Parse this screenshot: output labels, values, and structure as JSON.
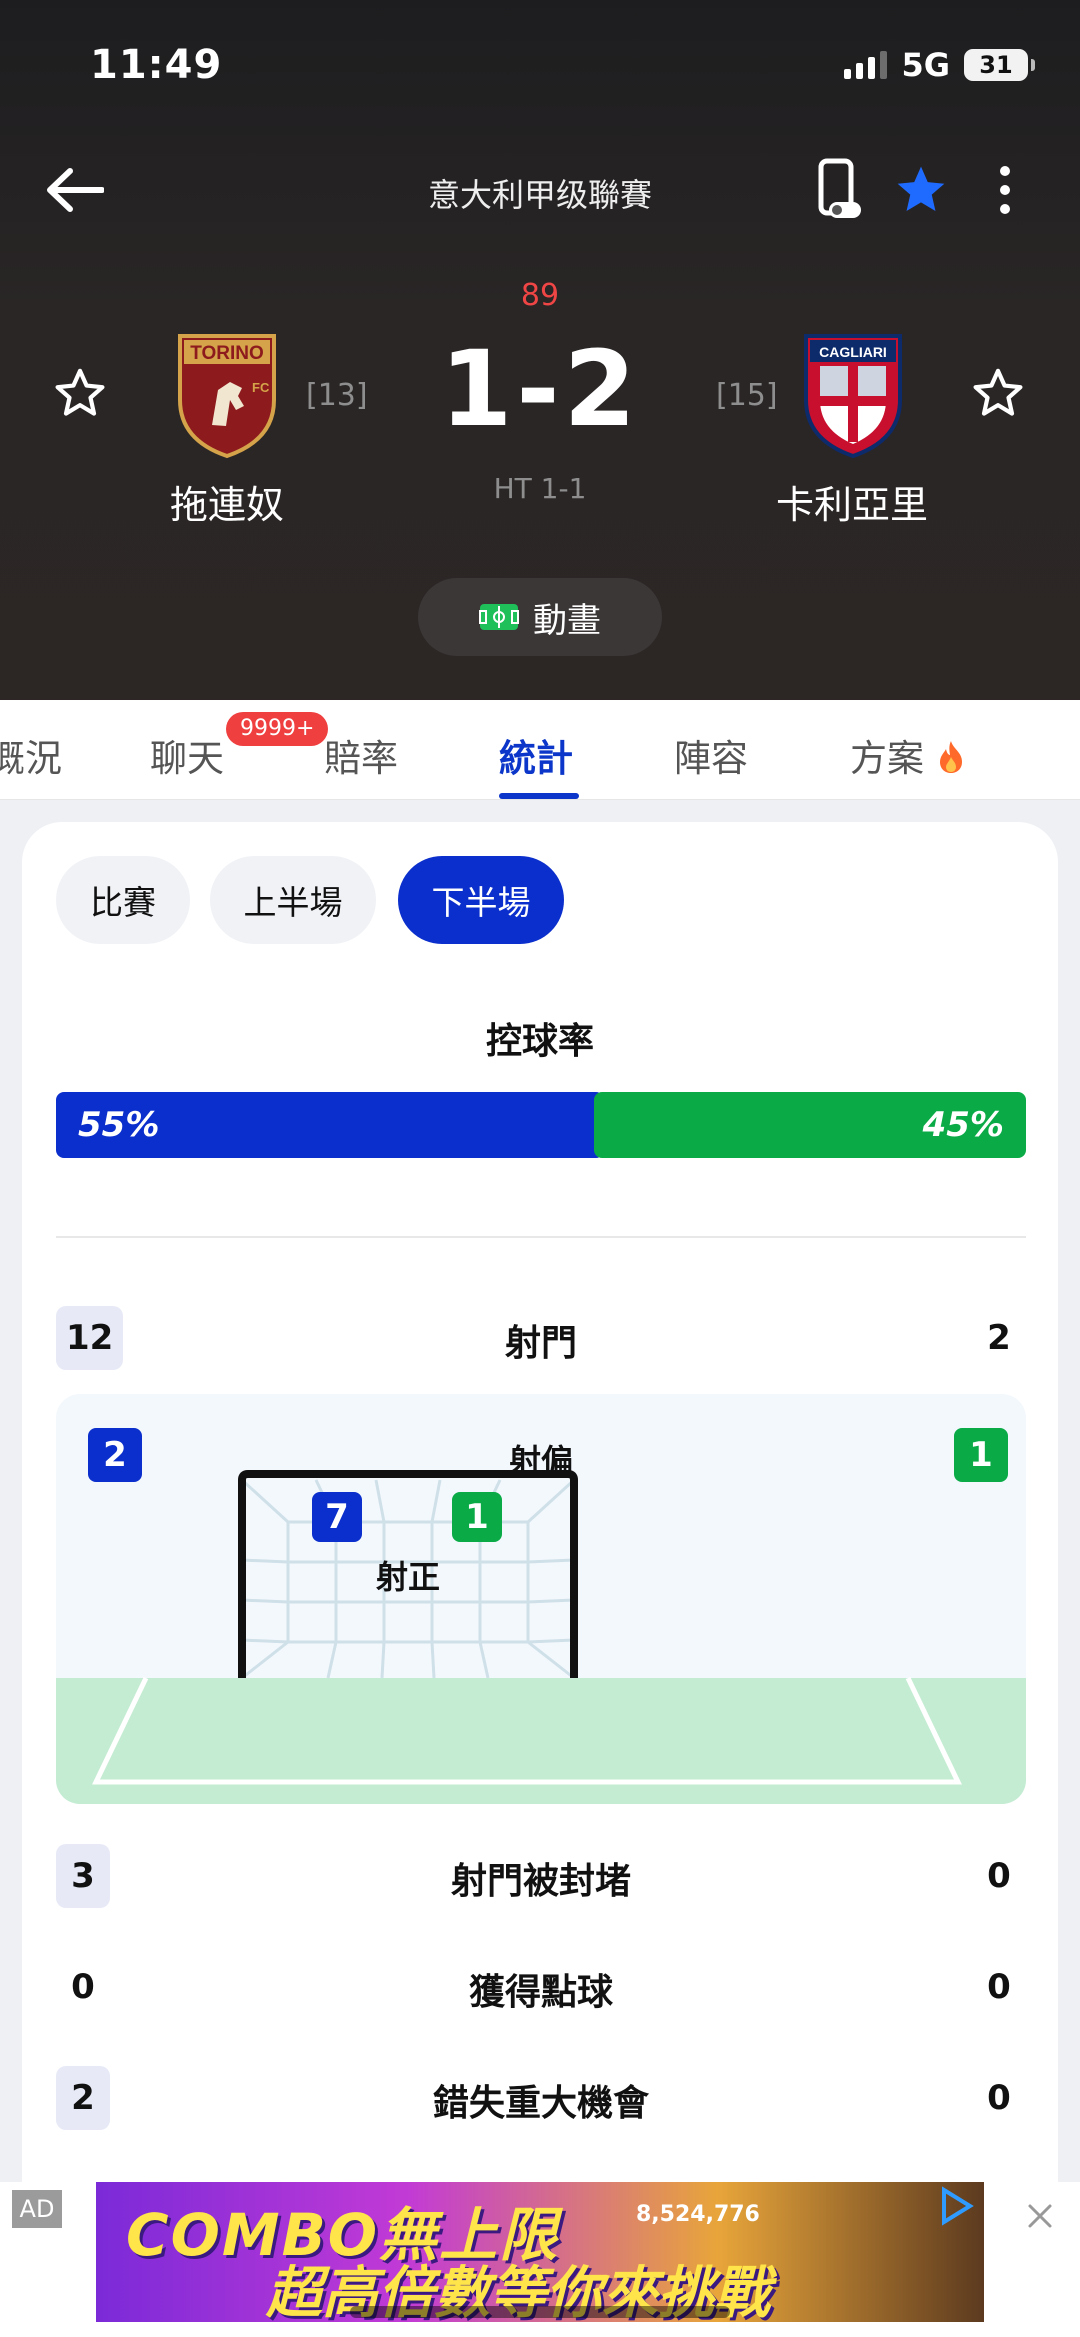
{
  "status_bar": {
    "time": "11:49",
    "network": "5G",
    "battery": "31"
  },
  "header": {
    "league": "意大利甲级聯賽",
    "minute": "89",
    "score": "1-2",
    "half_time": "HT 1-1",
    "home": {
      "name": "拖連奴",
      "rank": "[13]",
      "logo_text": "TORINO"
    },
    "away": {
      "name": "卡利亞里",
      "rank": "[15]",
      "logo_text": "CAGLIARI"
    },
    "animation_label": "動畫"
  },
  "tabs": [
    {
      "label": "概況"
    },
    {
      "label": "聊天",
      "badge": "9999+"
    },
    {
      "label": "賠率"
    },
    {
      "label": "統計",
      "active": true
    },
    {
      "label": "陣容"
    },
    {
      "label": "方案"
    }
  ],
  "segments": [
    {
      "label": "比賽"
    },
    {
      "label": "上半場"
    },
    {
      "label": "下半場",
      "active": true
    }
  ],
  "possession": {
    "title": "控球率",
    "home": "55%",
    "away": "45%",
    "home_value": 55,
    "away_value": 45
  },
  "shots": {
    "label": "射門",
    "home": "12",
    "away": "2",
    "off_target": {
      "label": "射偏",
      "home": "2",
      "away": "1"
    },
    "on_target": {
      "label": "射正",
      "home": "7",
      "away": "1"
    }
  },
  "stats": [
    {
      "name": "射門被封堵",
      "home": "3",
      "away": "0"
    },
    {
      "name": "獲得點球",
      "home": "0",
      "away": "0"
    },
    {
      "name": "錯失重大機會",
      "home": "2",
      "away": "0"
    }
  ],
  "ad": {
    "tag": "AD",
    "line1": "COMBO無上限",
    "line2": "超高倍數等你來挑戰",
    "jackpot": "8,524,776"
  },
  "colors": {
    "home": "#0b2fcc",
    "away": "#0aab47",
    "accent": "#0b36c9",
    "live": "#ef4545"
  }
}
